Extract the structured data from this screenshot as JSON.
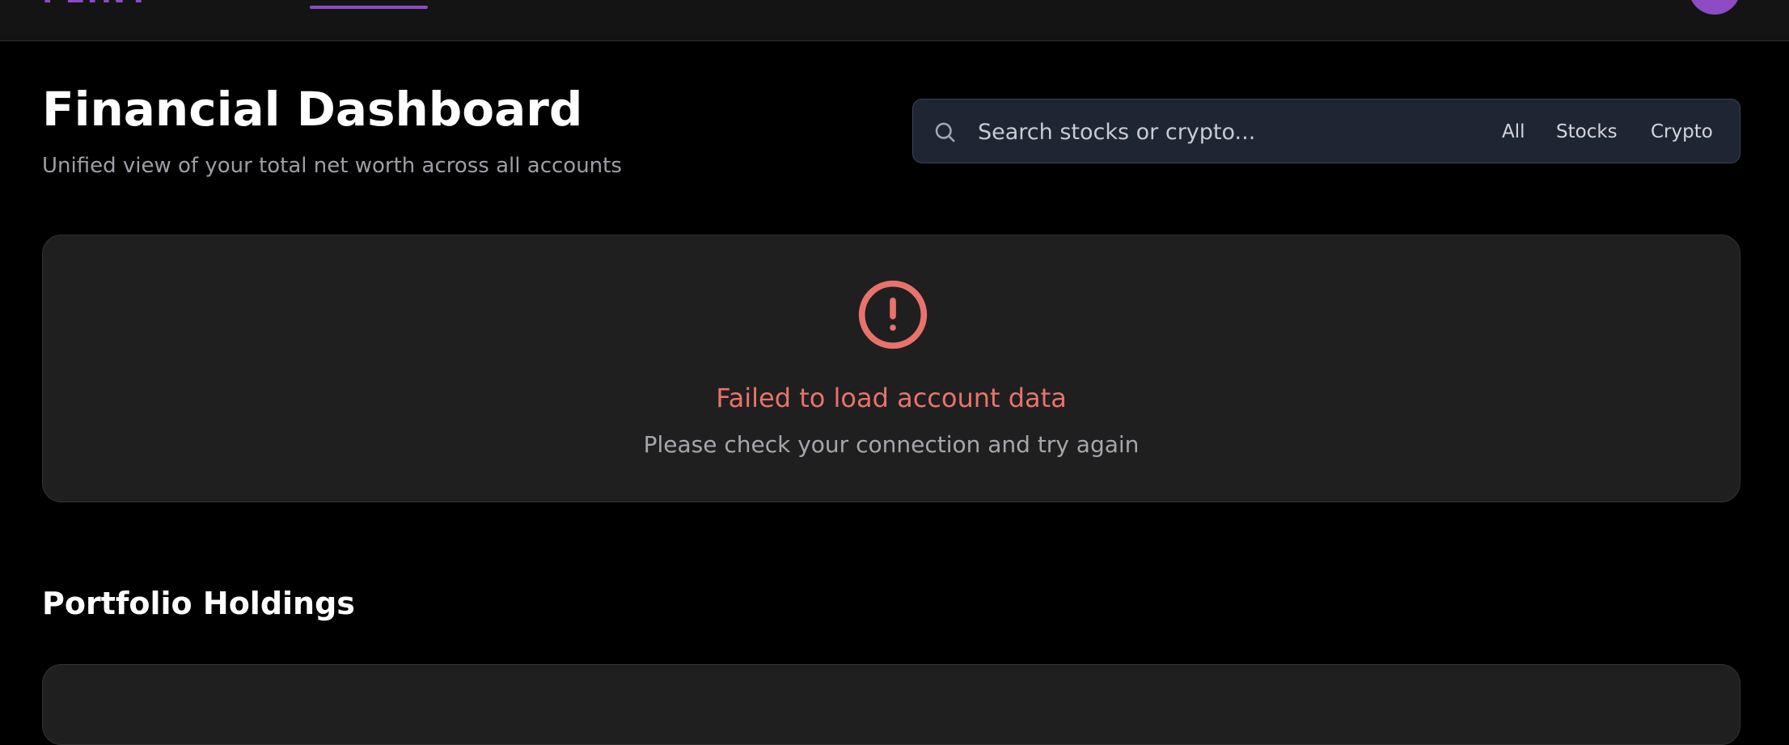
{
  "nav": {
    "logo": "FLINT"
  },
  "header": {
    "title": "Financial Dashboard",
    "subtitle": "Unified view of your total net worth across all accounts"
  },
  "search": {
    "placeholder": "Search stocks or crypto...",
    "value": "",
    "filters": [
      "All",
      "Stocks",
      "Crypto"
    ]
  },
  "error": {
    "title": "Failed to load account data",
    "message": "Please check your connection and try again"
  },
  "portfolio": {
    "heading": "Portfolio Holdings"
  },
  "colors": {
    "accent": "#8e4bc6",
    "error": "#e8736c",
    "background": "#000000",
    "card": "#1f1f1f",
    "search_bg": "#1f2633"
  }
}
